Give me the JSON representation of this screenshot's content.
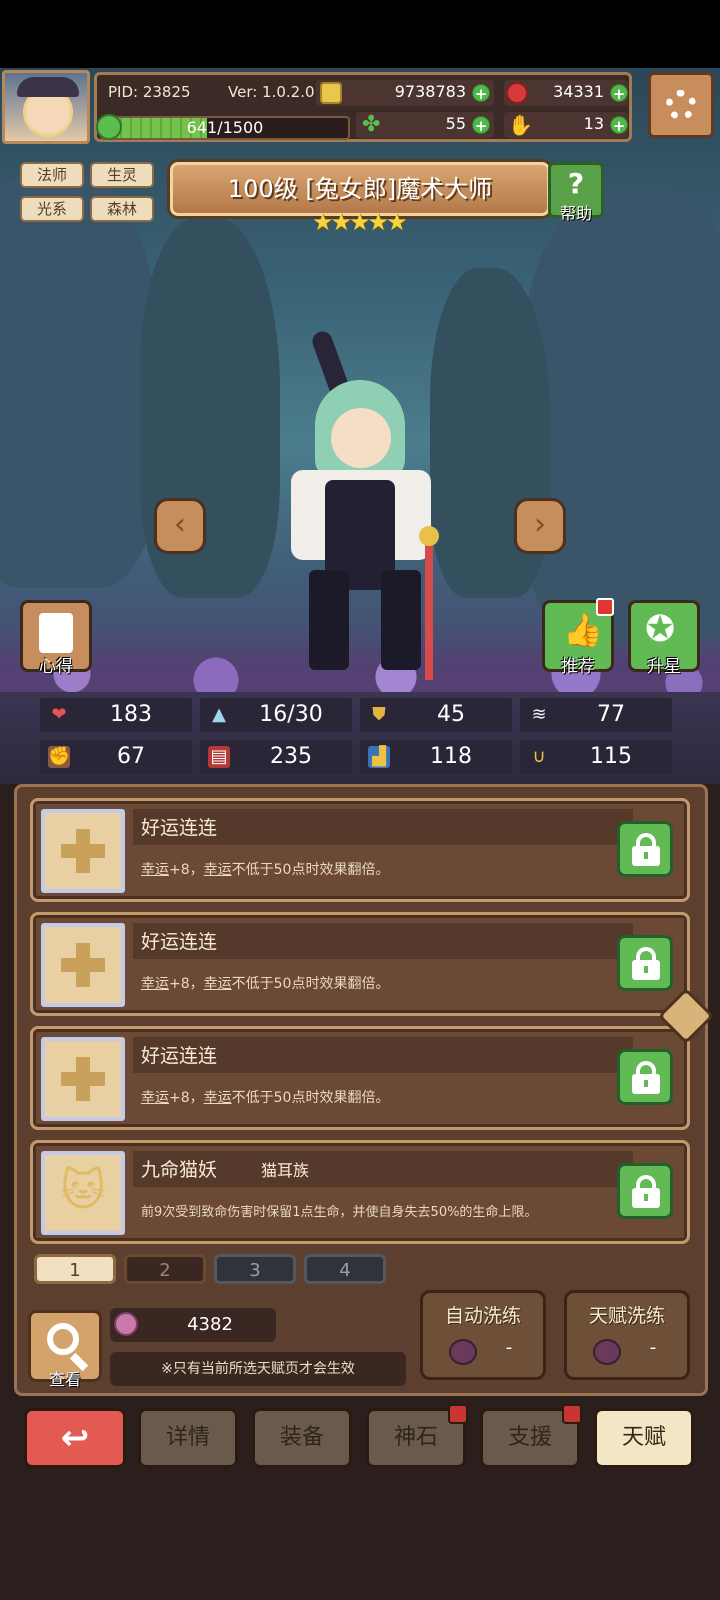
{
  "header": {
    "pid": "PID: 23825",
    "version": "Ver: 1.0.2.0",
    "gold": "9738783",
    "rubies": "34331",
    "clovers": "55",
    "hands": "13",
    "exp": "641/1500",
    "exp_fraction": 0.427
  },
  "tags": [
    "法师",
    "生灵",
    "光系",
    "森林"
  ],
  "hero": {
    "title": "100级 [兔女郎]魔术大师",
    "stars": 5,
    "stars_text": "★★★★★"
  },
  "buttons": {
    "help": "帮助",
    "insight": "心得",
    "recommend": "推荐",
    "star_up": "升星",
    "view": "查看"
  },
  "stats": [
    {
      "icon": "heart-icon",
      "value": "183"
    },
    {
      "icon": "mana-drop-icon",
      "value": "16/30"
    },
    {
      "icon": "shield-icon",
      "value": "45"
    },
    {
      "icon": "wing-icon",
      "value": "77"
    },
    {
      "icon": "fist-icon",
      "value": "67"
    },
    {
      "icon": "book-icon",
      "value": "235"
    },
    {
      "icon": "boot-icon",
      "value": "118"
    },
    {
      "icon": "horseshoe-icon",
      "value": "115"
    }
  ],
  "talents": [
    {
      "name": "好运连连",
      "subtitle": "",
      "desc_a": "幸运",
      "desc_b": "+8，",
      "desc_c": "幸运",
      "desc_d": "不低于50点时效果翻倍。"
    },
    {
      "name": "好运连连",
      "subtitle": "",
      "desc_a": "幸运",
      "desc_b": "+8，",
      "desc_c": "幸运",
      "desc_d": "不低于50点时效果翻倍。"
    },
    {
      "name": "好运连连",
      "subtitle": "",
      "desc_a": "幸运",
      "desc_b": "+8，",
      "desc_c": "幸运",
      "desc_d": "不低于50点时效果翻倍。"
    },
    {
      "name": "九命猫妖",
      "subtitle": "猫耳族",
      "desc_full": "前9次受到致命伤害时保留1点生命，并使自身失去50%的生命上限。"
    }
  ],
  "pages": [
    "1",
    "2",
    "3",
    "4"
  ],
  "bottom": {
    "potion_count": "4382",
    "note": "※只有当前所选天赋页才会生效",
    "auto_wash": "自动洗练",
    "talent_wash": "天赋洗练",
    "dash": "-"
  },
  "nav": {
    "details": "详情",
    "equip": "装备",
    "godstone": "神石",
    "support": "支援",
    "talent": "天赋"
  }
}
